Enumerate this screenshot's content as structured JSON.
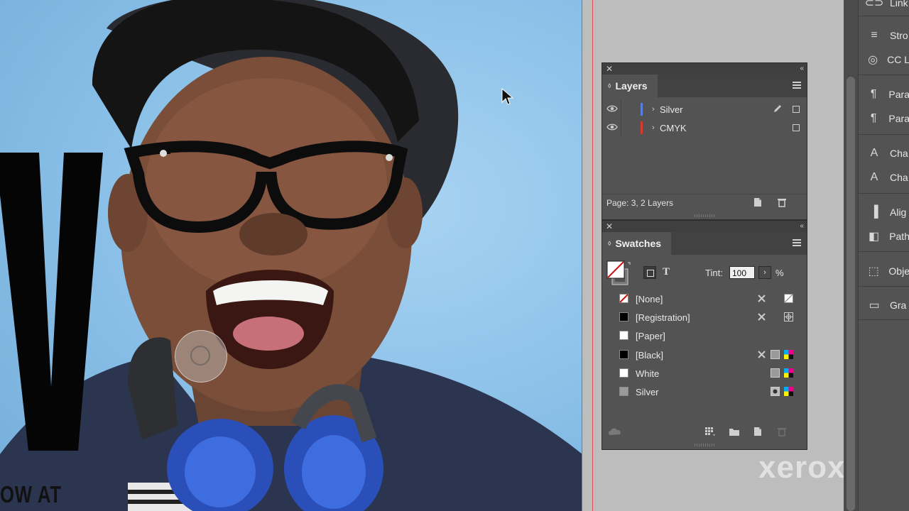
{
  "document": {
    "headline_fragment": "OW AT"
  },
  "watermark": {
    "text": "xerox",
    "tm": "™"
  },
  "layers_panel": {
    "title": "Layers",
    "layers": [
      {
        "name": "Silver",
        "color": "#5b7fe0"
      },
      {
        "name": "CMYK",
        "color": "#d93a2e"
      }
    ],
    "status": "Page: 3, 2 Layers"
  },
  "swatches_panel": {
    "title": "Swatches",
    "tint_label": "Tint:",
    "tint_value": "100",
    "tint_unit": "%",
    "swatches": [
      {
        "name": "[None]",
        "chip": "none"
      },
      {
        "name": "[Registration]",
        "chip": "#000000"
      },
      {
        "name": "[Paper]",
        "chip": "#ffffff"
      },
      {
        "name": "[Black]",
        "chip": "#000000"
      },
      {
        "name": "White",
        "chip": "#ffffff"
      },
      {
        "name": "Silver",
        "chip": "#9a9a9a"
      }
    ]
  },
  "dock": {
    "items": [
      {
        "label": "Links",
        "icon": "links-icon"
      },
      {
        "label": "Stroke",
        "icon": "stroke-icon"
      },
      {
        "label": "CC Libraries",
        "icon": "cc-libraries-icon"
      },
      {
        "label": "Paragraph",
        "icon": "paragraph-icon"
      },
      {
        "label": "Paragraph Styles",
        "icon": "paragraph-styles-icon"
      },
      {
        "label": "Character",
        "icon": "character-icon"
      },
      {
        "label": "Character Styles",
        "icon": "character-styles-icon"
      },
      {
        "label": "Align",
        "icon": "align-icon"
      },
      {
        "label": "Pathfinder",
        "icon": "pathfinder-icon"
      },
      {
        "label": "Object Styles",
        "icon": "object-styles-icon"
      },
      {
        "label": "Gradient",
        "icon": "gradient-icon"
      }
    ],
    "visible_labels": [
      "Link",
      "Stro",
      "CC L",
      "Para",
      "Para",
      "Cha",
      "Cha",
      "Alig",
      "Path",
      "Obje",
      "Gra"
    ]
  }
}
